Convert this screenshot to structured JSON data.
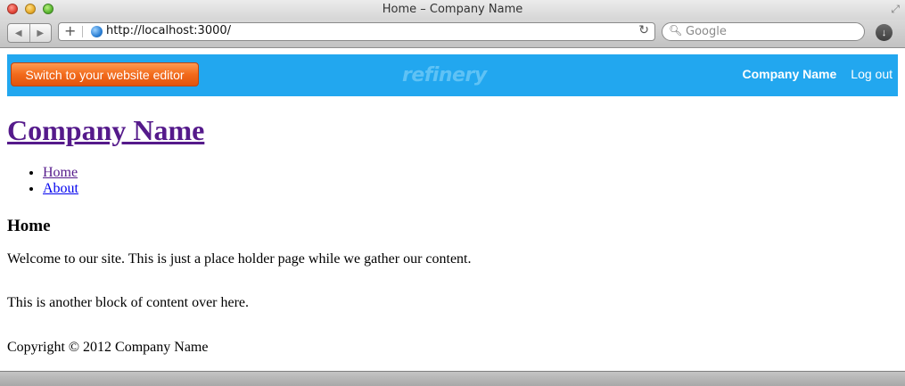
{
  "browser": {
    "window_title": "Home – Company Name",
    "url": "http://localhost:3000/",
    "search_placeholder": "Google"
  },
  "admin_bar": {
    "switch_label": "Switch to your website editor",
    "logo_text": "refinery",
    "company_label": "Company Name",
    "logout_label": "Log out",
    "bar_color": "#22a7ef",
    "button_color": "#f26a1b"
  },
  "page": {
    "site_title": "Company Name",
    "menu": [
      {
        "label": "Home"
      },
      {
        "label": "About"
      }
    ],
    "heading": "Home",
    "body": "Welcome to our site. This is just a place holder page while we gather our content.",
    "side_body": "This is another block of content over here.",
    "footer": "Copyright © 2012 Company Name"
  }
}
